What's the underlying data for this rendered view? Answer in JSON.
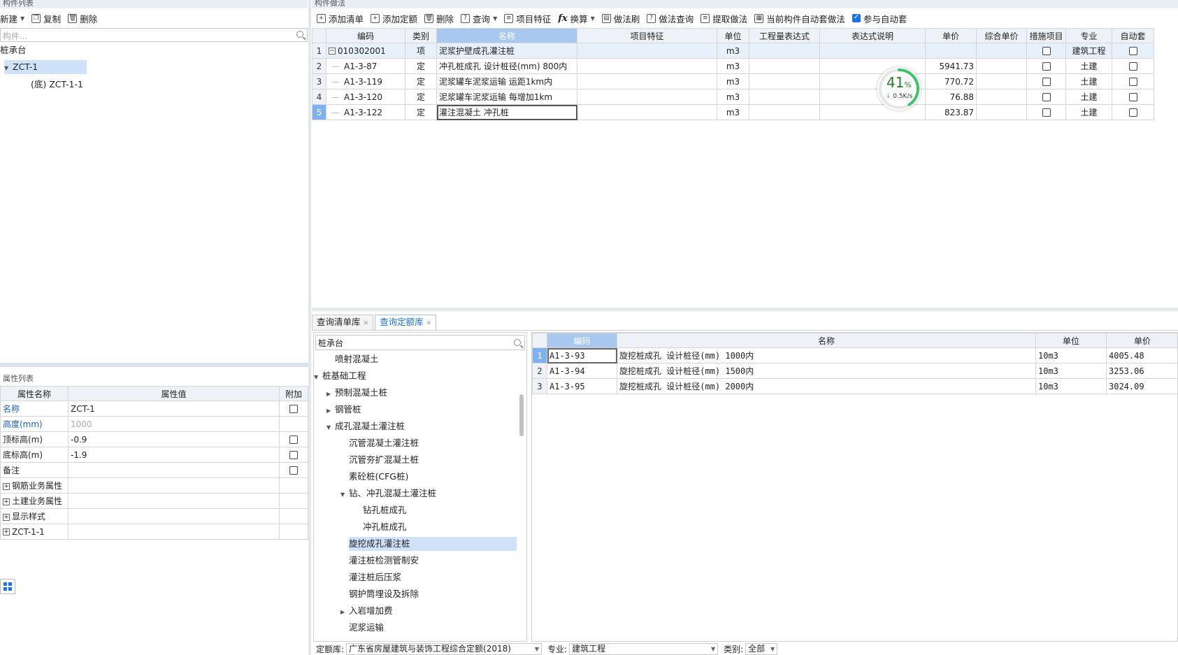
{
  "left_panel": {
    "title": "构件列表",
    "toolbar": {
      "new": "新建",
      "copy": "复制",
      "delete": "删除"
    },
    "search_placeholder": "构件...",
    "tree": {
      "root": "桩承台",
      "child": "ZCT-1",
      "grandchild": "(底) ZCT-1-1"
    }
  },
  "prop_panel": {
    "title": "属性列表",
    "headers": [
      "属性名称",
      "属性值",
      "附加"
    ],
    "rows": [
      {
        "name": "名称",
        "value": "ZCT-1"
      },
      {
        "name": "高度(mm)",
        "value": "1000"
      },
      {
        "name": "顶标高(m)",
        "value": "-0.9"
      },
      {
        "name": "底标高(m)",
        "value": "-1.9"
      },
      {
        "name": "备注",
        "value": ""
      },
      {
        "name": "钢筋业务属性",
        "value": ""
      },
      {
        "name": "土建业务属性",
        "value": ""
      },
      {
        "name": "显示样式",
        "value": ""
      },
      {
        "name": "ZCT-1-1",
        "value": ""
      }
    ]
  },
  "main_panel": {
    "title": "构件做法",
    "toolbar": {
      "add_list": "添加清单",
      "add_quota": "添加定额",
      "delete": "删除",
      "query": "查询",
      "item_feature": "项目特征",
      "convert": "换算",
      "method_brush": "做法刷",
      "method_query": "做法查询",
      "extract": "提取做法",
      "auto_method": "当前构件自动套做法",
      "participate_auto": "参与自动套"
    },
    "headers": [
      "编码",
      "类别",
      "名称",
      "项目特征",
      "单位",
      "工程量表达式",
      "表达式说明",
      "单价",
      "综合单价",
      "措施项目",
      "专业",
      "自动套"
    ],
    "rows": [
      {
        "num": "1",
        "code": "010302001",
        "type": "项",
        "name": "泥浆护壁成孔灌注桩",
        "unit": "m3",
        "price": "",
        "major": "建筑工程"
      },
      {
        "num": "2",
        "code": "A1-3-87",
        "type": "定",
        "name": "冲孔桩成孔 设计桩径(mm) 800内",
        "unit": "m3",
        "price": "5941.73",
        "major": "土建"
      },
      {
        "num": "3",
        "code": "A1-3-119",
        "type": "定",
        "name": "泥浆罐车泥浆运输 运距1km内",
        "unit": "m3",
        "price": "770.72",
        "major": "土建"
      },
      {
        "num": "4",
        "code": "A1-3-120",
        "type": "定",
        "name": "泥浆罐车泥浆运输 每增加1km",
        "unit": "m3",
        "price": "76.88",
        "major": "土建"
      },
      {
        "num": "5",
        "code": "A1-3-122",
        "type": "定",
        "name": "灌注混凝土 冲孔桩",
        "unit": "m3",
        "price": "823.87",
        "major": "土建"
      }
    ],
    "gauge": {
      "value": "41",
      "unit": "%",
      "speed": "0.5K/s",
      "level": 41
    }
  },
  "bottom_panel": {
    "tabs": [
      "查询清单库",
      "查询定额库"
    ],
    "search_value": "桩承台",
    "tree": [
      {
        "label": "喷射混凝土",
        "level": 2,
        "arrow": ""
      },
      {
        "label": "桩基础工程",
        "level": 1,
        "arrow": "down"
      },
      {
        "label": "预制混凝土桩",
        "level": 2,
        "arrow": "right"
      },
      {
        "label": "钢管桩",
        "level": 2,
        "arrow": "right"
      },
      {
        "label": "成孔混凝土灌注桩",
        "level": 2,
        "arrow": "down"
      },
      {
        "label": "沉管混凝土灌注桩",
        "level": 3,
        "arrow": ""
      },
      {
        "label": "沉管夯扩混凝土桩",
        "level": 3,
        "arrow": ""
      },
      {
        "label": "素砼桩(CFG桩)",
        "level": 3,
        "arrow": ""
      },
      {
        "label": "钻、冲孔混凝土灌注桩",
        "level": 3,
        "arrow": "down"
      },
      {
        "label": "钻孔桩成孔",
        "level": 4,
        "arrow": ""
      },
      {
        "label": "冲孔桩成孔",
        "level": 4,
        "arrow": ""
      },
      {
        "label": "旋挖成孔灌注桩",
        "level": 3,
        "arrow": "",
        "selected": true
      },
      {
        "label": "灌注桩检测管制安",
        "level": 3,
        "arrow": ""
      },
      {
        "label": "灌注桩后压浆",
        "level": 3,
        "arrow": ""
      },
      {
        "label": "钢护筒埋设及拆除",
        "level": 3,
        "arrow": ""
      },
      {
        "label": "入岩增加费",
        "level": 3,
        "arrow": "right"
      },
      {
        "label": "泥浆运输",
        "level": 3,
        "arrow": ""
      }
    ],
    "headers": [
      "编码",
      "名称",
      "单位",
      "单价"
    ],
    "rows": [
      {
        "num": "1",
        "code": "A1-3-93",
        "name": "旋挖桩成孔 设计桩径(mm) 1000内",
        "unit": "10m3",
        "price": "4005.48"
      },
      {
        "num": "2",
        "code": "A1-3-94",
        "name": "旋挖桩成孔 设计桩径(mm) 1500内",
        "unit": "10m3",
        "price": "3253.06"
      },
      {
        "num": "3",
        "code": "A1-3-95",
        "name": "旋挖桩成孔 设计桩径(mm) 2000内",
        "unit": "10m3",
        "price": "3024.09"
      }
    ],
    "status": {
      "quota_lib_label": "定额库:",
      "quota_lib_value": "广东省房屋建筑与装饰工程综合定额(2018)",
      "major_label": "专业:",
      "major_value": "建筑工程",
      "category_label": "类别:",
      "category_value": "全部"
    }
  }
}
